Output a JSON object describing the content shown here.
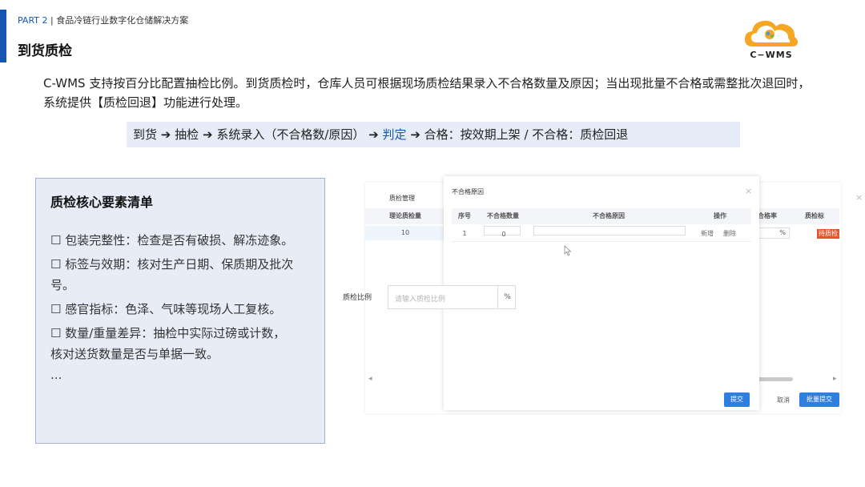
{
  "header": {
    "part": "PART 2",
    "separator": "|",
    "section": "食品冷链行业数字化仓储解决方案",
    "title": "到货质检",
    "logo_text": "C−WMS"
  },
  "intro": "C-WMS 支持按百分比配置抽检比例。到货质检时，仓库人员可根据现场质检结果录入不合格数量及原因；当出现批量不合格或需整批次退回时，系统提供【质检回退】功能进行处理。",
  "flow": {
    "step1": "到货",
    "step2": "抽检",
    "step3": "系统录入（不合格数/原因）",
    "step4": "判定",
    "step5": "合格：按效期上架 / 不合格：质检回退",
    "arrow": "➔"
  },
  "checklist": {
    "title": "质检核心要素清单",
    "items": [
      "☐ 包装完整性：检查是否有破损、解冻迹象。",
      "☐ 标签与效期：核对生产日期、保质期及批次号。",
      "☐ 感官指标：色泽、气味等现场人工复核。",
      "☐ 数量/重量差异：抽检中实际过磅或计数，核对送货数量是否与单据一致。"
    ],
    "more": "..."
  },
  "screenshot": {
    "back_dialog": {
      "title": "质检管理",
      "col_theory": "理论质检量",
      "theory_value": "10",
      "col_rate": "合格率",
      "rate_unit": "%",
      "col_flag": "质检标",
      "flag_badge": "待质检",
      "cancel": "取消",
      "batch_submit": "批量提交",
      "close": "×"
    },
    "modal": {
      "title": "不合格原因",
      "close": "×",
      "headers": [
        "序号",
        "不合格数量",
        "不合格原因",
        "操作"
      ],
      "row": {
        "index": "1",
        "qty": "0",
        "reason": "",
        "add": "新增",
        "delete": "删除"
      },
      "submit": "提交"
    },
    "ratio": {
      "label": "质检比例",
      "placeholder": "请输入质检比例",
      "unit": "%"
    },
    "scroll_left": "◂",
    "scroll_right": "▸"
  },
  "colors": {
    "brand_blue": "#1557b0",
    "button_blue": "#2f7fe0",
    "logo_orange": "#f5a623",
    "badge_red": "#e4572e"
  }
}
